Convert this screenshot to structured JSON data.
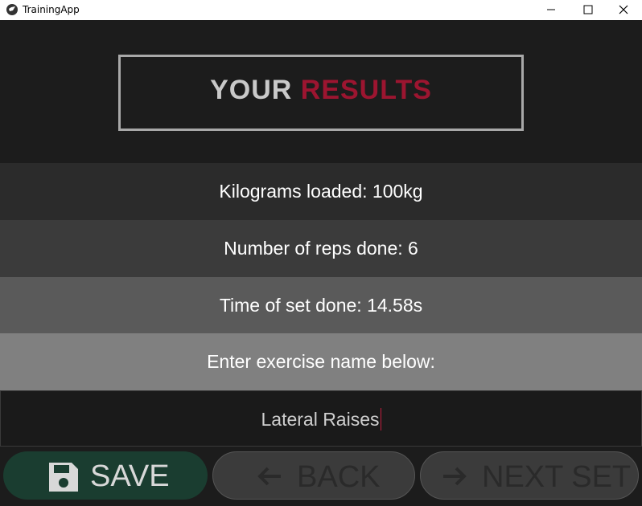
{
  "window": {
    "title": "TrainingApp"
  },
  "logo": {
    "word1": "YOUR",
    "word2": "RESULTS"
  },
  "results": {
    "kilograms": "Kilograms loaded: 100kg",
    "reps": "Number of reps done: 6",
    "time": "Time of set done: 14.58s",
    "prompt": "Enter exercise name below:"
  },
  "exercise_input": {
    "value": "Lateral Raises"
  },
  "buttons": {
    "save": "SAVE",
    "back": "BACK",
    "next": "NEXT SET"
  },
  "icons": {
    "save": "floppy-disk-icon",
    "back": "arrow-left-icon",
    "next": "arrow-right-icon"
  },
  "colors": {
    "accent": "#9c1530",
    "save_bg": "#1a3d30"
  }
}
